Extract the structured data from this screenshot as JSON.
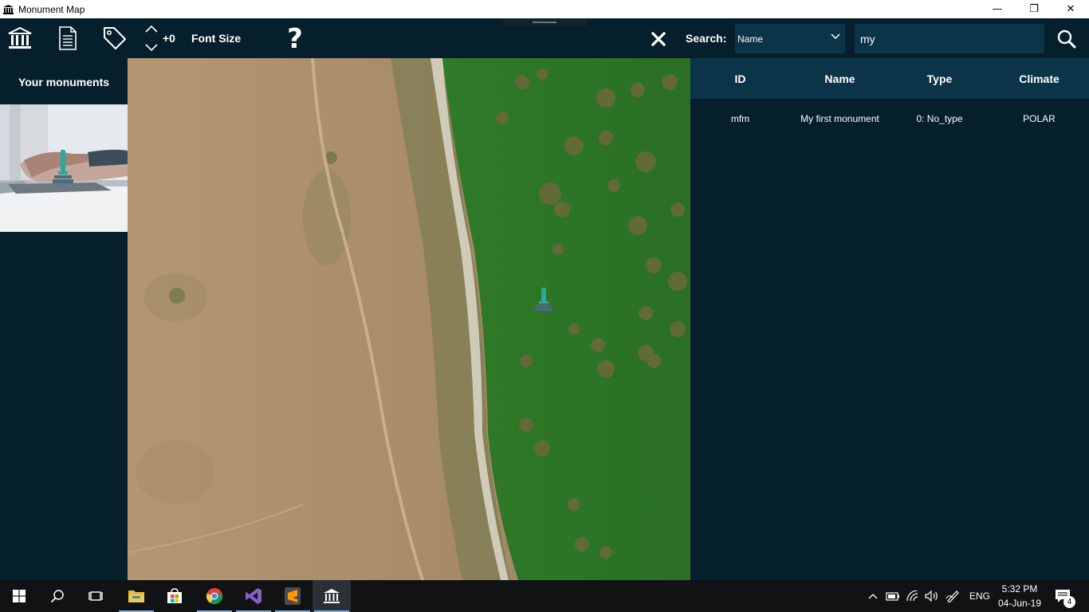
{
  "window": {
    "title": "Monument Map",
    "controls": {
      "minimize": "—",
      "restore": "❐",
      "close": "✕"
    }
  },
  "toolbar": {
    "font_size_value": "+0",
    "font_size_label": "Font Size",
    "help_label": "?",
    "search_label": "Search:",
    "search_field": {
      "selected": "Name"
    },
    "search_query": "my",
    "icons": [
      "monument-icon",
      "document-icon",
      "tag-icon",
      "chevron-up-icon",
      "chevron-down-icon",
      "help-icon",
      "close-icon",
      "search-icon"
    ]
  },
  "sidebar": {
    "heading": "Your monuments"
  },
  "results": {
    "columns": [
      "ID",
      "Name",
      "Type",
      "Climate"
    ],
    "rows": [
      {
        "id": "mfm",
        "name": "My first monument",
        "type": "0: No_type",
        "climate": "POLAR"
      }
    ]
  },
  "taskbar": {
    "lang": "ENG",
    "time": "5:32 PM",
    "date": "04-Jun-19",
    "notification_count": "4",
    "apps": [
      "start-icon",
      "search-icon",
      "task-view-icon",
      "file-explorer-icon",
      "store-icon",
      "chrome-icon",
      "visual-studio-icon",
      "sublime-text-icon",
      "monument-map-icon"
    ]
  },
  "colors": {
    "background": "#061f2c",
    "panel": "#0c3448",
    "monument_teal": "#2aa8a0",
    "taskbar": "#101214"
  }
}
